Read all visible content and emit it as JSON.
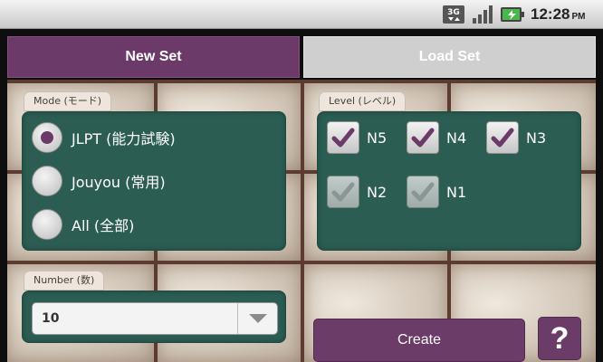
{
  "status_bar": {
    "network": "3G",
    "time": "12:28",
    "ampm": "PM",
    "icons": [
      "3g-icon",
      "signal-icon",
      "battery-charging-icon"
    ]
  },
  "tabs": [
    {
      "label": "New Set",
      "selected": true
    },
    {
      "label": "Load Set",
      "selected": false
    }
  ],
  "mode": {
    "label": "Mode (モード)",
    "options": [
      {
        "label": "JLPT (能力試験)",
        "selected": true
      },
      {
        "label": "Jouyou (常用)",
        "selected": false
      },
      {
        "label": "All (全部)",
        "selected": false
      }
    ]
  },
  "level": {
    "label": "Level (レベル)",
    "items": [
      {
        "label": "N5",
        "checked": true,
        "enabled": true
      },
      {
        "label": "N4",
        "checked": true,
        "enabled": true
      },
      {
        "label": "N3",
        "checked": true,
        "enabled": true
      },
      {
        "label": "N2",
        "checked": true,
        "enabled": false
      },
      {
        "label": "N1",
        "checked": true,
        "enabled": false
      }
    ]
  },
  "number": {
    "label": "Number (数)",
    "value": "10"
  },
  "actions": {
    "create_label": "Create",
    "help_label": "?"
  },
  "colors": {
    "accent": "#6b3a68",
    "panel": "#2b5d53",
    "tab_inactive": "#cfcfcf"
  }
}
